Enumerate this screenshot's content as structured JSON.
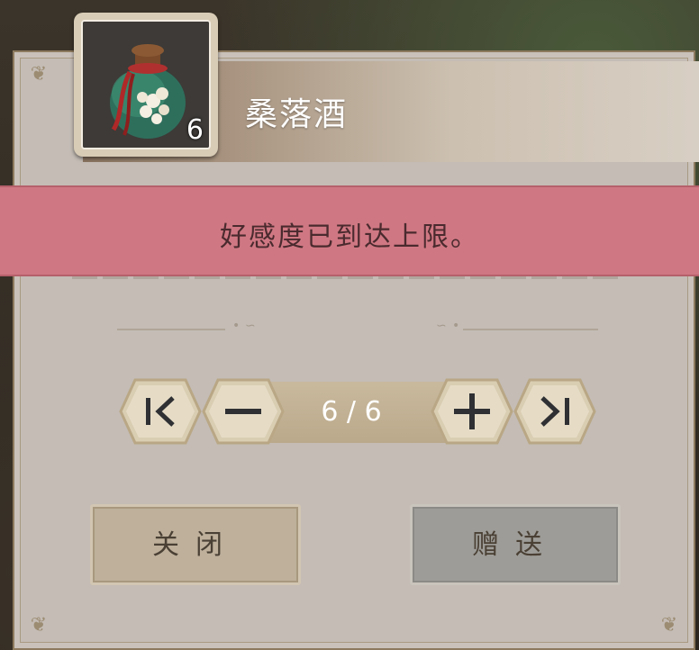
{
  "item": {
    "name": "桑落酒",
    "count": "6",
    "icon": "wine-jar-icon"
  },
  "toast": {
    "message": "好感度已到达上限。"
  },
  "stepper": {
    "value": "6 / 6",
    "first_icon": "skip-to-first-icon",
    "minus_icon": "minus-icon",
    "plus_icon": "plus-icon",
    "last_icon": "skip-to-last-icon"
  },
  "buttons": {
    "close_label": "关闭",
    "give_label": "赠送"
  },
  "colors": {
    "panel": "#c4bcb5",
    "toast": "#cf7883",
    "close_button": "#beb09b",
    "give_button": "#9e9c98"
  }
}
